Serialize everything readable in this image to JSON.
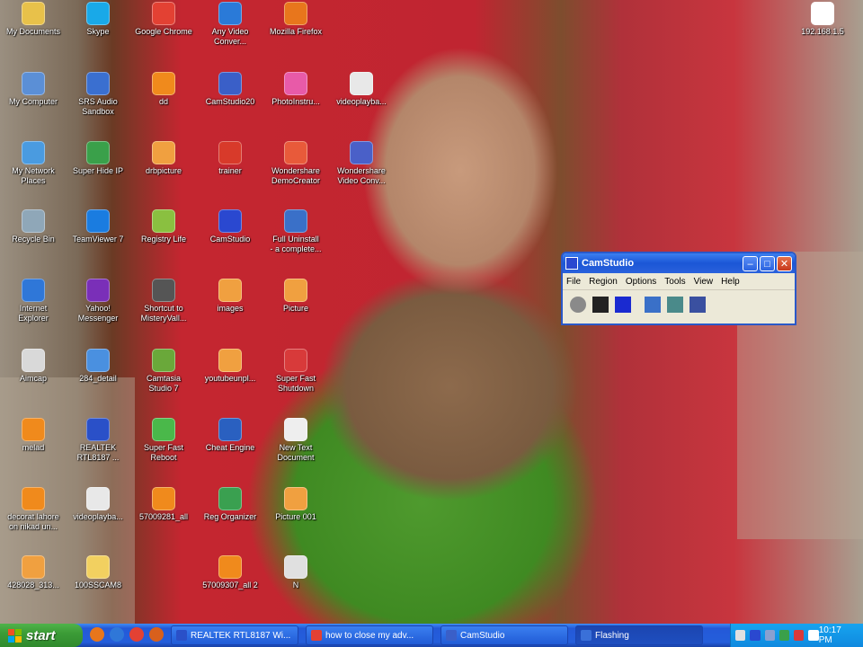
{
  "desktop": {
    "icons": [
      {
        "label": "My Documents",
        "icon": "folder-documents-icon",
        "color": "#e8c14a"
      },
      {
        "label": "My Computer",
        "icon": "computer-icon",
        "color": "#5b8fd6"
      },
      {
        "label": "My Network\nPlaces",
        "icon": "network-places-icon",
        "color": "#4a9be0"
      },
      {
        "label": "Recycle Bin",
        "icon": "recycle-bin-icon",
        "color": "#8fa7b8"
      },
      {
        "label": "Internet\nExplorer",
        "icon": "internet-explorer-icon",
        "color": "#2f77d8"
      },
      {
        "label": "Aimcap",
        "icon": "app-icon",
        "color": "#d9d9d9"
      },
      {
        "label": "melad",
        "icon": "vlc-media-icon",
        "color": "#f08a1c"
      },
      {
        "label": "decorat lahore\non nikad un...",
        "icon": "vlc-media-icon",
        "color": "#f08a1c"
      },
      {
        "label": "428028_313...",
        "icon": "image-file-icon",
        "color": "#f0a040"
      },
      {
        "label": "Skype",
        "icon": "skype-icon",
        "color": "#19a9e8"
      },
      {
        "label": "SRS Audio\nSandbox",
        "icon": "audio-icon",
        "color": "#3a6fd0"
      },
      {
        "label": "Super Hide IP",
        "icon": "shield-icon",
        "color": "#3aa04a"
      },
      {
        "label": "TeamViewer 7",
        "icon": "teamviewer-icon",
        "color": "#1a7ce0"
      },
      {
        "label": "Yahoo!\nMessenger",
        "icon": "yahoo-messenger-icon",
        "color": "#7a2fb8"
      },
      {
        "label": "284_detail",
        "icon": "image-file-icon",
        "color": "#4a90e0"
      },
      {
        "label": "REALTEK\nRTL8187 ...",
        "icon": "network-adapter-icon",
        "color": "#2a50c8"
      },
      {
        "label": "videoplayba...",
        "icon": "text-file-icon",
        "color": "#e8e8e8"
      },
      {
        "label": "100SSCAM8",
        "icon": "folder-icon",
        "color": "#f2d060"
      },
      {
        "label": "Google Chrome",
        "icon": "chrome-icon",
        "color": "#e34133"
      },
      {
        "label": "dd",
        "icon": "vlc-media-icon",
        "color": "#f08a1c"
      },
      {
        "label": "drbpicture",
        "icon": "image-file-icon",
        "color": "#f0a040"
      },
      {
        "label": "Registry Life",
        "icon": "registry-icon",
        "color": "#8ac040"
      },
      {
        "label": "Shortcut to\nMisteryVall...",
        "icon": "shortcut-icon",
        "color": "#555555"
      },
      {
        "label": "Camtasia\nStudio 7",
        "icon": "camtasia-icon",
        "color": "#6aa83a"
      },
      {
        "label": "Super Fast\nReboot",
        "icon": "reboot-icon",
        "color": "#4ab84a"
      },
      {
        "label": "57009281_all",
        "icon": "vlc-media-icon",
        "color": "#f08a1c"
      },
      {
        "label": "57009307_all 2",
        "icon": "vlc-media-icon",
        "color": "#f08a1c"
      },
      {
        "label": "Any Video\nConver...",
        "icon": "video-converter-icon",
        "color": "#2a7ad8"
      },
      {
        "label": "CamStudio20",
        "icon": "camstudio-icon",
        "color": "#3a5fc8"
      },
      {
        "label": "trainer",
        "icon": "trainer-icon",
        "color": "#d83a2a"
      },
      {
        "label": "CamStudio",
        "icon": "camstudio-icon",
        "color": "#2a48d0"
      },
      {
        "label": "images",
        "icon": "image-file-icon",
        "color": "#f0a040"
      },
      {
        "label": "youtubeunpl...",
        "icon": "image-file-icon",
        "color": "#f0a040"
      },
      {
        "label": "Cheat Engine",
        "icon": "cheat-engine-icon",
        "color": "#2a60c0"
      },
      {
        "label": "Reg Organizer",
        "icon": "reg-organizer-icon",
        "color": "#3aa050"
      },
      {
        "label": "Mozilla Firefox",
        "icon": "firefox-icon",
        "color": "#e8761c"
      },
      {
        "label": "PhotoInstru...",
        "icon": "photo-instrument-icon",
        "color": "#e85aa8"
      },
      {
        "label": "Wondershare\nDemoCreator",
        "icon": "democreator-icon",
        "color": "#e85a3a"
      },
      {
        "label": "Full Uninstall\n- a complete...",
        "icon": "uninstall-icon",
        "color": "#3a70c8"
      },
      {
        "label": "Picture",
        "icon": "image-file-icon",
        "color": "#f0a040"
      },
      {
        "label": "Super Fast\nShutdown",
        "icon": "shutdown-icon",
        "color": "#d83a3a"
      },
      {
        "label": "New Text\nDocument",
        "icon": "text-file-icon",
        "color": "#eeeeee"
      },
      {
        "label": "Picture 001",
        "icon": "image-file-icon",
        "color": "#f0a040"
      },
      {
        "label": "N",
        "icon": "image-file-icon",
        "color": "#e0e0e0"
      },
      {
        "label": "videoplayba...",
        "icon": "text-file-icon",
        "color": "#e8e8e8"
      },
      {
        "label": "Wondershare\nVideo Conv...",
        "icon": "video-converter-icon",
        "color": "#4a60c8"
      },
      {
        "label": "192.168.1.5",
        "icon": "vnc-viewer-icon",
        "color": "#ffffff"
      }
    ]
  },
  "camstudio": {
    "title": "CamStudio",
    "menu": [
      "File",
      "Region",
      "Options",
      "Tools",
      "View",
      "Help"
    ],
    "toolbar": [
      {
        "name": "record-icon",
        "color": "#8a8a8a"
      },
      {
        "name": "pause-icon",
        "color": "#222222"
      },
      {
        "name": "stop-icon",
        "color": "#1a2ad0"
      },
      {
        "name": "annotation-icon",
        "color": "#3a70c8"
      },
      {
        "name": "autopan-icon",
        "color": "#4a8a8a"
      },
      {
        "name": "audio-icon",
        "color": "#3a50a0"
      }
    ]
  },
  "taskbar": {
    "start_label": "start",
    "quick_launch": [
      {
        "name": "firefox-icon",
        "color": "#e8761c"
      },
      {
        "name": "internet-explorer-icon",
        "color": "#2f77d8"
      },
      {
        "name": "chrome-icon",
        "color": "#e34133"
      },
      {
        "name": "firefox-icon",
        "color": "#d8601c"
      }
    ],
    "tasks": [
      {
        "label": "REALTEK RTL8187 Wi...",
        "icon": "network-adapter-icon",
        "color": "#2a50c8"
      },
      {
        "label": "how to close my adv...",
        "icon": "chrome-icon",
        "color": "#e34133"
      },
      {
        "label": "CamStudio",
        "icon": "camstudio-icon",
        "color": "#3a5fc8"
      },
      {
        "label": "Flashing",
        "icon": "window-icon",
        "color": "#3a70d8"
      }
    ],
    "tray_icons": [
      {
        "name": "speaker-icon",
        "color": "#e0e0e0"
      },
      {
        "name": "camstudio-tray-icon",
        "color": "#2a48d0"
      },
      {
        "name": "network-icon",
        "color": "#8aa0d0"
      },
      {
        "name": "shield-icon",
        "color": "#3aa04a"
      },
      {
        "name": "security-icon",
        "color": "#d83a3a"
      },
      {
        "name": "vnc-icon",
        "color": "#ffffff"
      }
    ],
    "clock": "10:17 PM"
  }
}
